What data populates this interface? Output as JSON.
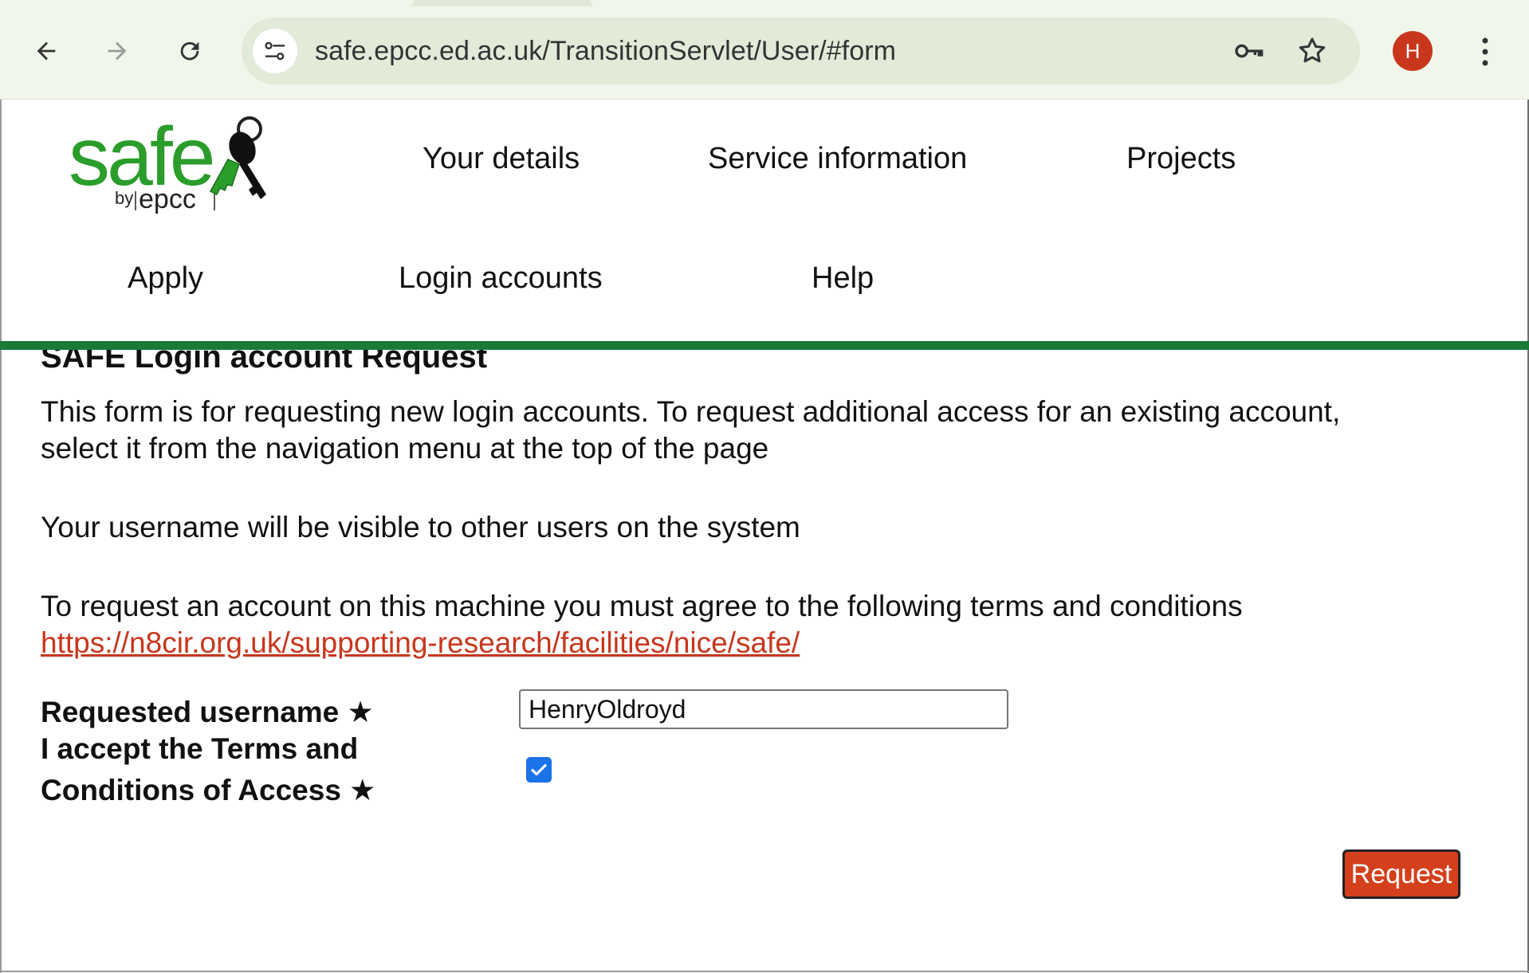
{
  "browser": {
    "url": "safe.epcc.ed.ac.uk/TransitionServlet/User/#form",
    "profile_initial": "H",
    "icons": [
      "back-arrow-icon",
      "forward-arrow-icon",
      "reload-icon",
      "site-settings-icon",
      "password-key-icon",
      "bookmark-star-icon",
      "kebab-menu-icon"
    ]
  },
  "logo": {
    "word": "safe",
    "by": "by",
    "org": "epcc"
  },
  "nav": {
    "your_details": "Your details",
    "service_information": "Service information",
    "projects": "Projects",
    "apply": "Apply",
    "login_accounts": "Login accounts",
    "help": "Help"
  },
  "form": {
    "title": "SAFE Login account Request",
    "intro_line1": "This form is for requesting new login accounts. To request additional access for an existing account,",
    "intro_line2": "select it from the navigation menu at the top of the page",
    "username_note": "Your username will be visible to other users on the system",
    "terms_text": "To request an account on this machine you must agree to the following terms and conditions",
    "terms_link": "https://n8cir.org.uk/supporting-research/facilities/nice/safe/",
    "username_label": "Requested username ★",
    "username_value": "HenryOldroyd",
    "accept_label_line1": "I accept the Terms and",
    "accept_label_line2": "Conditions of Access ★",
    "accept_checked": true,
    "submit_label": "Request"
  },
  "colors": {
    "brand_green": "#1a7a37",
    "link_red": "#c8361c",
    "button_red": "#d4401c",
    "checkbox_blue": "#1a73e8"
  }
}
